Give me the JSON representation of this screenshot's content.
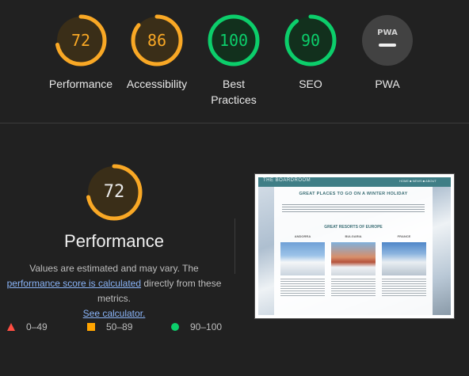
{
  "gauges": [
    {
      "label": "Performance",
      "score": "72",
      "value": 0.72,
      "color": "#f9a825",
      "track": "#4a3a1a"
    },
    {
      "label": "Accessibility",
      "score": "86",
      "value": 0.86,
      "color": "#f9a825",
      "track": "#4a3a1a"
    },
    {
      "label": "Best Practices",
      "score": "100",
      "value": 1.0,
      "color": "#0cce6b",
      "track": "#133a22"
    },
    {
      "label": "SEO",
      "score": "90",
      "value": 0.9,
      "color": "#0cce6b",
      "track": "#133a22"
    },
    {
      "label": "PWA",
      "score": "",
      "value": 0,
      "color": "#e8e8e8",
      "track": "#424242",
      "icon": "pwa-icon"
    }
  ],
  "performance": {
    "score": "72",
    "value": 0.72,
    "title": "Performance",
    "desc_part1": "Values are estimated and may vary. The ",
    "desc_link1": "performance score is calculated",
    "desc_part2": " directly from these metrics. ",
    "desc_link2": "See calculator."
  },
  "legend": [
    {
      "icon": "triangle-icon",
      "range": "0–49",
      "color": "#ff4e42"
    },
    {
      "icon": "square-icon",
      "range": "50–89",
      "color": "#ffa400"
    },
    {
      "icon": "circle-icon",
      "range": "90–100",
      "color": "#0cce6b"
    }
  ],
  "screenshot": {
    "brand": "THE BOARDROOM",
    "nav": "HOME ■ NEWS ■ ABOUT",
    "heading": "GREAT PLACES TO GO ON A WINTER HOLIDAY",
    "subheading": "GREAT RESORTS OF EUROPE",
    "columns": [
      "ANDORRA",
      "BULGARIA",
      "FRANCE"
    ]
  }
}
